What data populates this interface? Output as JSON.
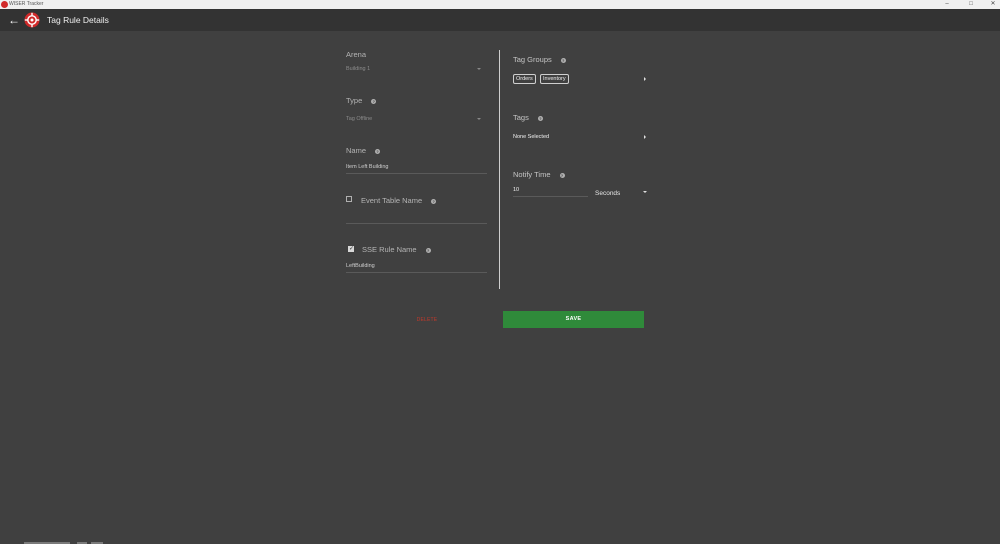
{
  "window": {
    "title": "WISER Tracker"
  },
  "app_bar": {
    "title": "Tag Rule Details"
  },
  "form": {
    "arena": {
      "label": "Arena",
      "value": "Building 1"
    },
    "type": {
      "label": "Type",
      "value": "Tag Offline"
    },
    "name": {
      "label": "Name",
      "value": "Item Left Building"
    },
    "event_table": {
      "label": "Event Table Name",
      "checked": false,
      "value": ""
    },
    "sse_rule": {
      "label": "SSE Rule Name",
      "checked": true,
      "value": "LeftBuilding"
    },
    "tag_groups": {
      "label": "Tag Groups",
      "chips": [
        "Orders",
        "Inventory"
      ]
    },
    "tags": {
      "label": "Tags",
      "value": "None Selected"
    },
    "notify_time": {
      "label": "Notify Time",
      "value": "10",
      "unit": "Seconds"
    }
  },
  "actions": {
    "delete_label": "DELETE",
    "save_label": "SAVE"
  },
  "colors": {
    "background": "#404040",
    "app_bar": "#333333",
    "save": "#2f8a3a",
    "delete": "#c0392b",
    "brand": "#d12a2a"
  }
}
